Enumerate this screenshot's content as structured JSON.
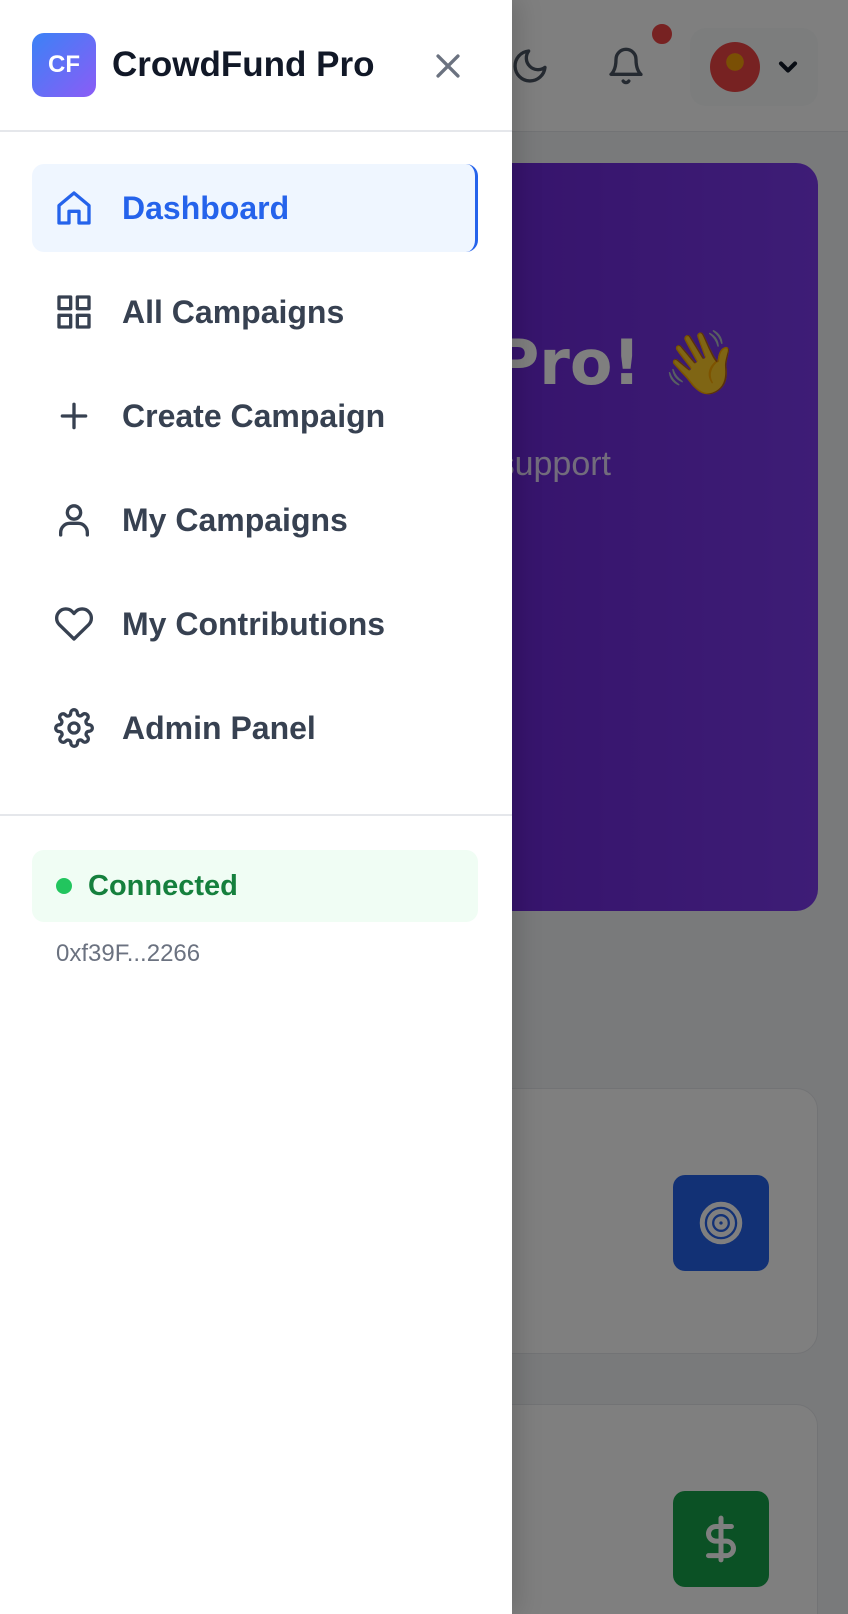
{
  "app": {
    "logo_text": "CF",
    "name": "CrowdFund Pro"
  },
  "sidebar": {
    "items": [
      {
        "label": "Dashboard",
        "icon": "home-icon",
        "active": true
      },
      {
        "label": "All Campaigns",
        "icon": "grid-icon",
        "active": false
      },
      {
        "label": "Create Campaign",
        "icon": "plus-icon",
        "active": false
      },
      {
        "label": "My Campaigns",
        "icon": "user-icon",
        "active": false
      },
      {
        "label": "My Contributions",
        "icon": "heart-icon",
        "active": false
      },
      {
        "label": "Admin Panel",
        "icon": "gear-icon",
        "active": false
      }
    ]
  },
  "wallet": {
    "status": "Connected",
    "address": "0xf39F...2266"
  },
  "colors": {
    "accent": "#2563eb",
    "active_bg": "#eff6ff",
    "connected_bg": "#f0fdf4",
    "connected_text": "#15803d",
    "hero_gradient_start": "#4f46e5",
    "hero_gradient_end": "#7c3aed"
  },
  "background": {
    "hero_title_visible": "g\nPro! 👋",
    "hero_sub_visible": "ts, support\nch your own"
  }
}
